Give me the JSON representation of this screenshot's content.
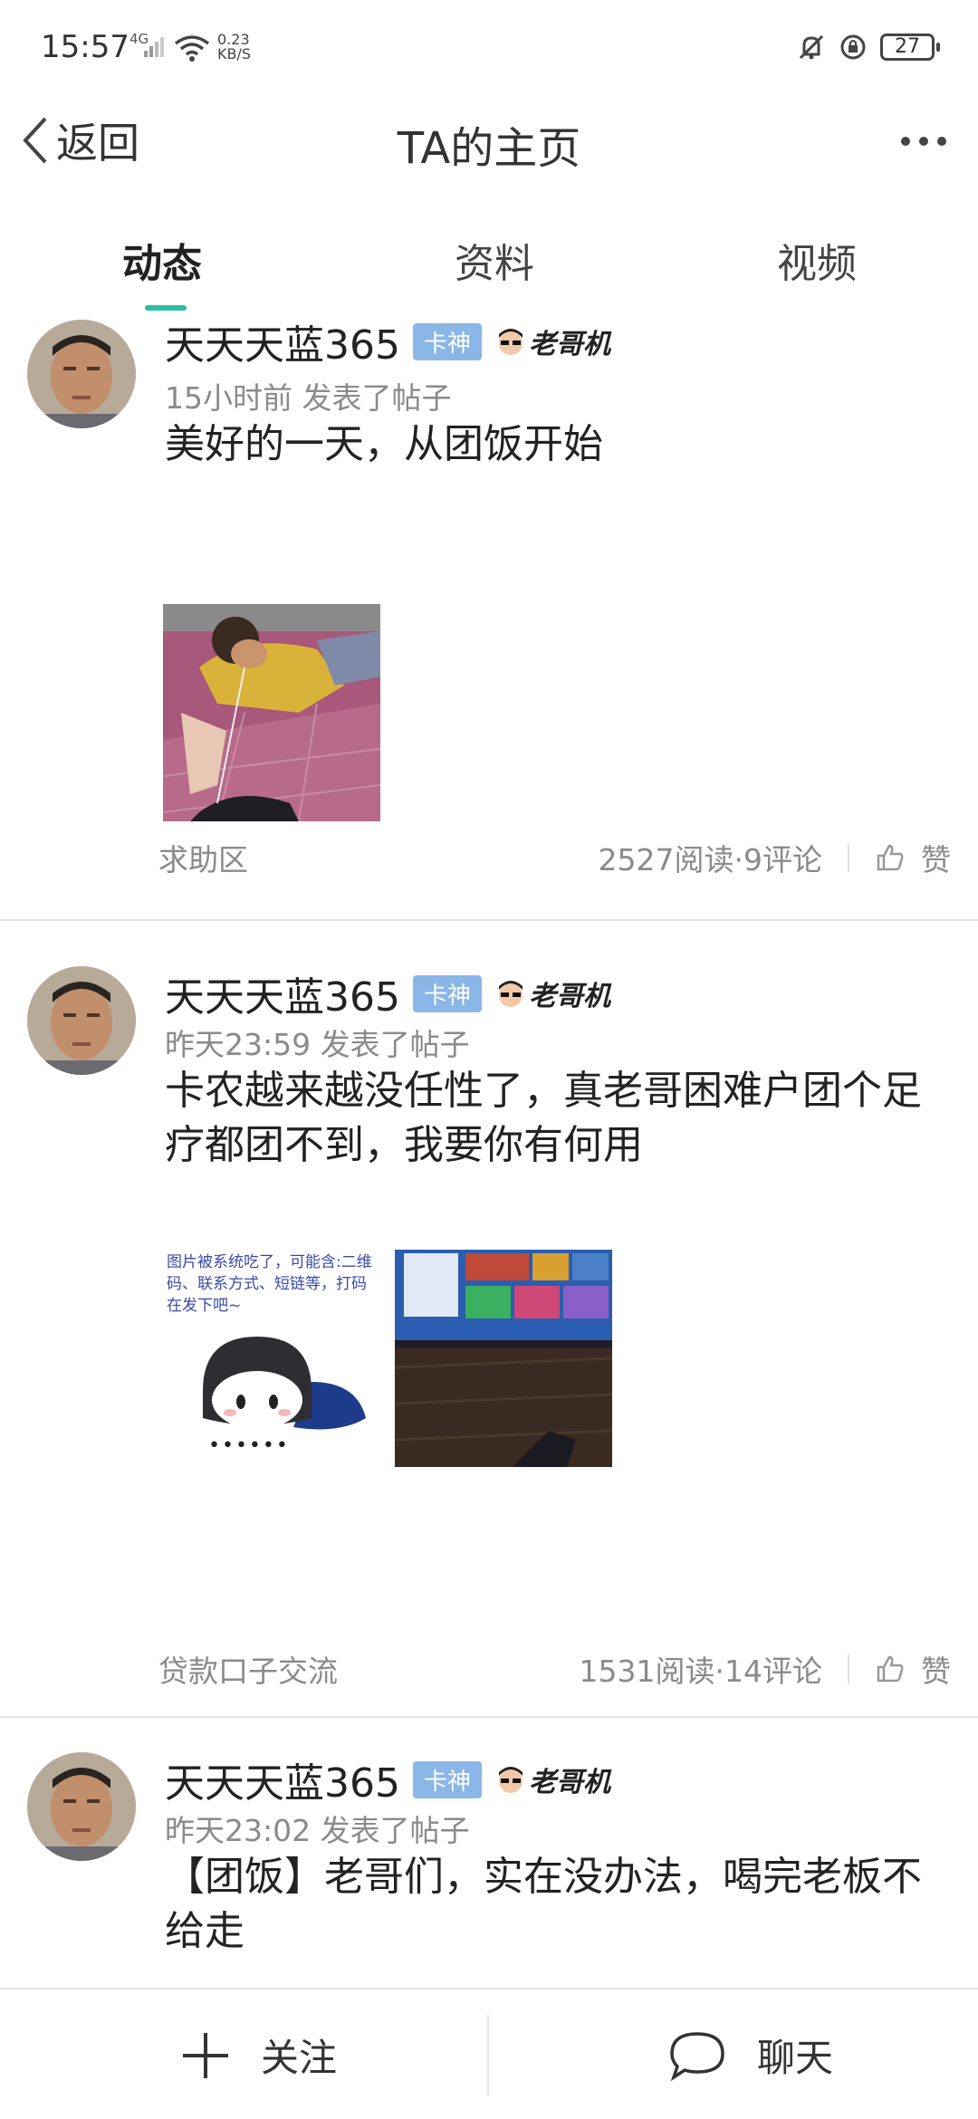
{
  "status_bar": {
    "time": "15:57",
    "network": "4G",
    "speed_value": "0.23",
    "speed_unit": "KB/S",
    "battery": "27"
  },
  "header": {
    "back_label": "返回",
    "title": "TA的主页"
  },
  "tabs": [
    {
      "label": "动态"
    },
    {
      "label": "资料"
    },
    {
      "label": "视频"
    }
  ],
  "posts": [
    {
      "username": "天天天蓝365",
      "badge": "卡神",
      "driver_badge": "老哥机",
      "time": "15小时前",
      "action": "发表了帖子",
      "content": "美好的一天，从团饭开始",
      "category": "求助区",
      "stats": "2527阅读·9评论",
      "like_label": "赞"
    },
    {
      "username": "天天天蓝365",
      "badge": "卡神",
      "driver_badge": "老哥机",
      "time": "昨天23:59",
      "action": "发表了帖子",
      "content": "卡农越来越没任性了，真老哥困难户团个足疗都团不到，我要你有何用",
      "image_notice": "图片被系统吃了，可能含:二维码、联系方式、短链等，打码在发下吧~",
      "image_notice_dots": "••••••",
      "category": "贷款口子交流",
      "stats": "1531阅读·14评论",
      "like_label": "赞"
    },
    {
      "username": "天天天蓝365",
      "badge": "卡神",
      "driver_badge": "老哥机",
      "time": "昨天23:02",
      "action": "发表了帖子",
      "content": "【团饭】老哥们，实在没办法，喝完老板不给走"
    }
  ],
  "bottom_bar": {
    "follow_label": "关注",
    "chat_label": "聊天"
  },
  "colors": {
    "accent": "#2bbfa5",
    "badge": "#8ab6e8",
    "meta_text": "#8a8a8a"
  }
}
